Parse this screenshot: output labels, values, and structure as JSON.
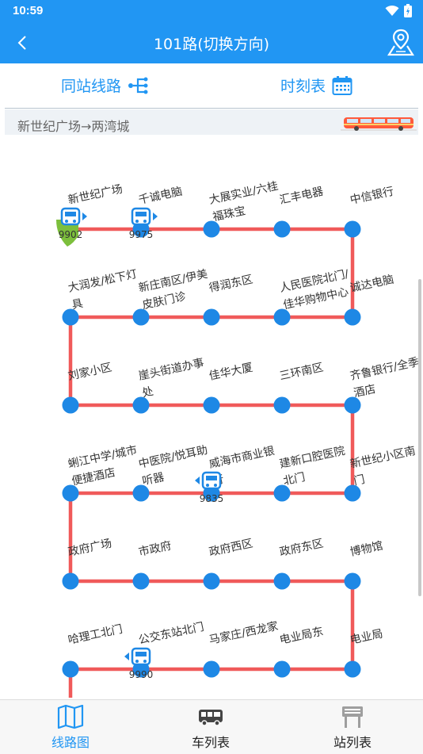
{
  "status": {
    "time": "10:59"
  },
  "header": {
    "title": "101路(切换方向)"
  },
  "toolbar": {
    "same_station": "同站线路",
    "timetable": "时刻表"
  },
  "direction": "新世纪广场→两湾城",
  "colors": {
    "primary": "#2196f3",
    "route_line": "#f05a5a",
    "station": "#1e88e5",
    "bus": "#1e88e5",
    "current_marker": "#7cbf3c"
  },
  "stations": [
    {
      "name": "新世纪广场",
      "row": 0,
      "col": 0,
      "label_lines": [
        "新世纪广场"
      ],
      "current": true
    },
    {
      "name": "千诚电脑",
      "row": 0,
      "col": 1,
      "label_lines": [
        "千诚电脑"
      ]
    },
    {
      "name": "大展实业/六桂福珠宝",
      "row": 0,
      "col": 2,
      "label_lines": [
        "大展实业/六桂",
        "福珠宝"
      ]
    },
    {
      "name": "汇丰电器",
      "row": 0,
      "col": 3,
      "label_lines": [
        "汇丰电器"
      ]
    },
    {
      "name": "中信银行",
      "row": 0,
      "col": 4,
      "label_lines": [
        "中信银行"
      ]
    },
    {
      "name": "诚达电脑",
      "row": 1,
      "col": 4,
      "label_lines": [
        "诚达电脑"
      ]
    },
    {
      "name": "人民医院北门/佳华购物中心",
      "row": 1,
      "col": 3,
      "label_lines": [
        "人民医院北门/",
        "佳华购物中心"
      ]
    },
    {
      "name": "得润东区",
      "row": 1,
      "col": 2,
      "label_lines": [
        "得润东区"
      ]
    },
    {
      "name": "新庄南区/伊美皮肤门诊",
      "row": 1,
      "col": 1,
      "label_lines": [
        "新庄南区/伊美",
        "皮肤门诊"
      ]
    },
    {
      "name": "大润发/松下灯具",
      "row": 1,
      "col": 0,
      "label_lines": [
        "大润发/松下灯",
        "具"
      ]
    },
    {
      "name": "刘家小区",
      "row": 2,
      "col": 0,
      "label_lines": [
        "刘家小区"
      ]
    },
    {
      "name": "崖头街道办事处",
      "row": 2,
      "col": 1,
      "label_lines": [
        "崖头街道办事",
        "处"
      ]
    },
    {
      "name": "佳华大厦",
      "row": 2,
      "col": 2,
      "label_lines": [
        "佳华大厦"
      ]
    },
    {
      "name": "三环南区",
      "row": 2,
      "col": 3,
      "label_lines": [
        "三环南区"
      ]
    },
    {
      "name": "齐鲁银行/全季酒店",
      "row": 2,
      "col": 4,
      "label_lines": [
        "齐鲁银行/全季",
        "酒店"
      ]
    },
    {
      "name": "新世纪小区南门",
      "row": 3,
      "col": 4,
      "label_lines": [
        "新世纪小区南",
        "门"
      ]
    },
    {
      "name": "建新口腔医院北门",
      "row": 3,
      "col": 3,
      "label_lines": [
        "建新口腔医院",
        "北门"
      ]
    },
    {
      "name": "威海市商业银行",
      "row": 3,
      "col": 2,
      "label_lines": [
        "威海市商业银",
        "行"
      ]
    },
    {
      "name": "中医院/悦耳助听器",
      "row": 3,
      "col": 1,
      "label_lines": [
        "中医院/悦耳助",
        "听器"
      ]
    },
    {
      "name": "蜊江中学/城市便捷酒店",
      "row": 3,
      "col": 0,
      "label_lines": [
        "蜊江中学/城市",
        "便捷酒店"
      ]
    },
    {
      "name": "政府广场",
      "row": 4,
      "col": 0,
      "label_lines": [
        "政府广场"
      ]
    },
    {
      "name": "市政府",
      "row": 4,
      "col": 1,
      "label_lines": [
        "市政府"
      ]
    },
    {
      "name": "政府西区",
      "row": 4,
      "col": 2,
      "label_lines": [
        "政府西区"
      ]
    },
    {
      "name": "政府东区",
      "row": 4,
      "col": 3,
      "label_lines": [
        "政府东区"
      ]
    },
    {
      "name": "博物馆",
      "row": 4,
      "col": 4,
      "label_lines": [
        "博物馆"
      ]
    },
    {
      "name": "电业局",
      "row": 5,
      "col": 4,
      "label_lines": [
        "电业局"
      ]
    },
    {
      "name": "电业局东",
      "row": 5,
      "col": 3,
      "label_lines": [
        "电业局东"
      ]
    },
    {
      "name": "马家庄/西龙家",
      "row": 5,
      "col": 2,
      "label_lines": [
        "马家庄/西龙家"
      ]
    },
    {
      "name": "公交东站北门",
      "row": 5,
      "col": 1,
      "label_lines": [
        "公交东站北门"
      ]
    },
    {
      "name": "哈理工北门",
      "row": 5,
      "col": 0,
      "label_lines": [
        "哈理工北门"
      ]
    }
  ],
  "buses": [
    {
      "id": "9902",
      "row": 0,
      "col": 0,
      "direction": "right"
    },
    {
      "id": "9975",
      "row": 0,
      "col": 1,
      "direction": "right"
    },
    {
      "id": "9835",
      "row": 3,
      "col": 2,
      "direction": "left"
    },
    {
      "id": "9990",
      "row": 5,
      "col": 1,
      "direction": "left"
    }
  ],
  "nav": [
    {
      "label": "线路图",
      "icon": "map-icon",
      "active": true
    },
    {
      "label": "车列表",
      "icon": "bus-icon",
      "active": false
    },
    {
      "label": "站列表",
      "icon": "bus-stop-icon",
      "active": false
    }
  ]
}
